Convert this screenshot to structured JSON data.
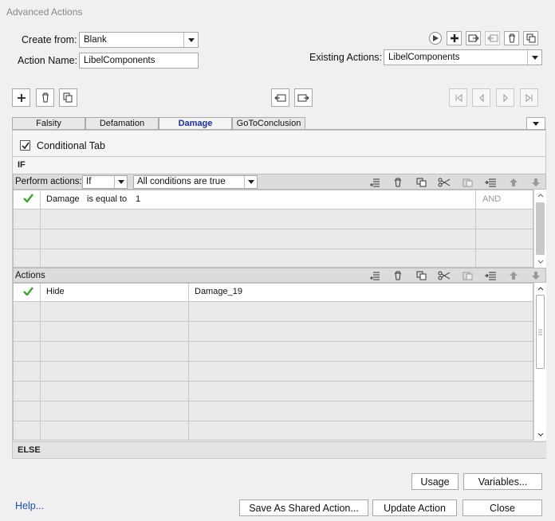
{
  "window": {
    "title": "Advanced Actions"
  },
  "header": {
    "create_from_label": "Create from:",
    "create_from_value": "Blank",
    "action_name_label": "Action Name:",
    "action_name_value": "LibelComponents",
    "existing_actions_label": "Existing Actions:",
    "existing_actions_value": "LibelComponents"
  },
  "tabs": [
    {
      "label": "Falsity"
    },
    {
      "label": "Defamation"
    },
    {
      "label": "Damage"
    },
    {
      "label": "GoToConclusion"
    }
  ],
  "conditional": {
    "label": "Conditional Tab",
    "checked": true
  },
  "if_section": {
    "title": "IF",
    "perform_label": "Perform actions:",
    "perform_value": "If",
    "conditions_value": "All conditions are true",
    "rows": [
      {
        "variable": "Damage",
        "operator": "is equal to",
        "value": "1",
        "join": "AND"
      }
    ]
  },
  "actions_section": {
    "title": "Actions",
    "rows": [
      {
        "action": "Hide",
        "target": "Damage_19"
      }
    ]
  },
  "else_section": {
    "title": "ELSE"
  },
  "footer": {
    "usage": "Usage",
    "variables": "Variables...",
    "help": "Help...",
    "save_shared": "Save As Shared Action...",
    "update": "Update Action",
    "close": "Close"
  },
  "colors": {
    "check": "#3aa52a",
    "link": "#1a4fb4",
    "active_tab": "#1a2f9a"
  }
}
